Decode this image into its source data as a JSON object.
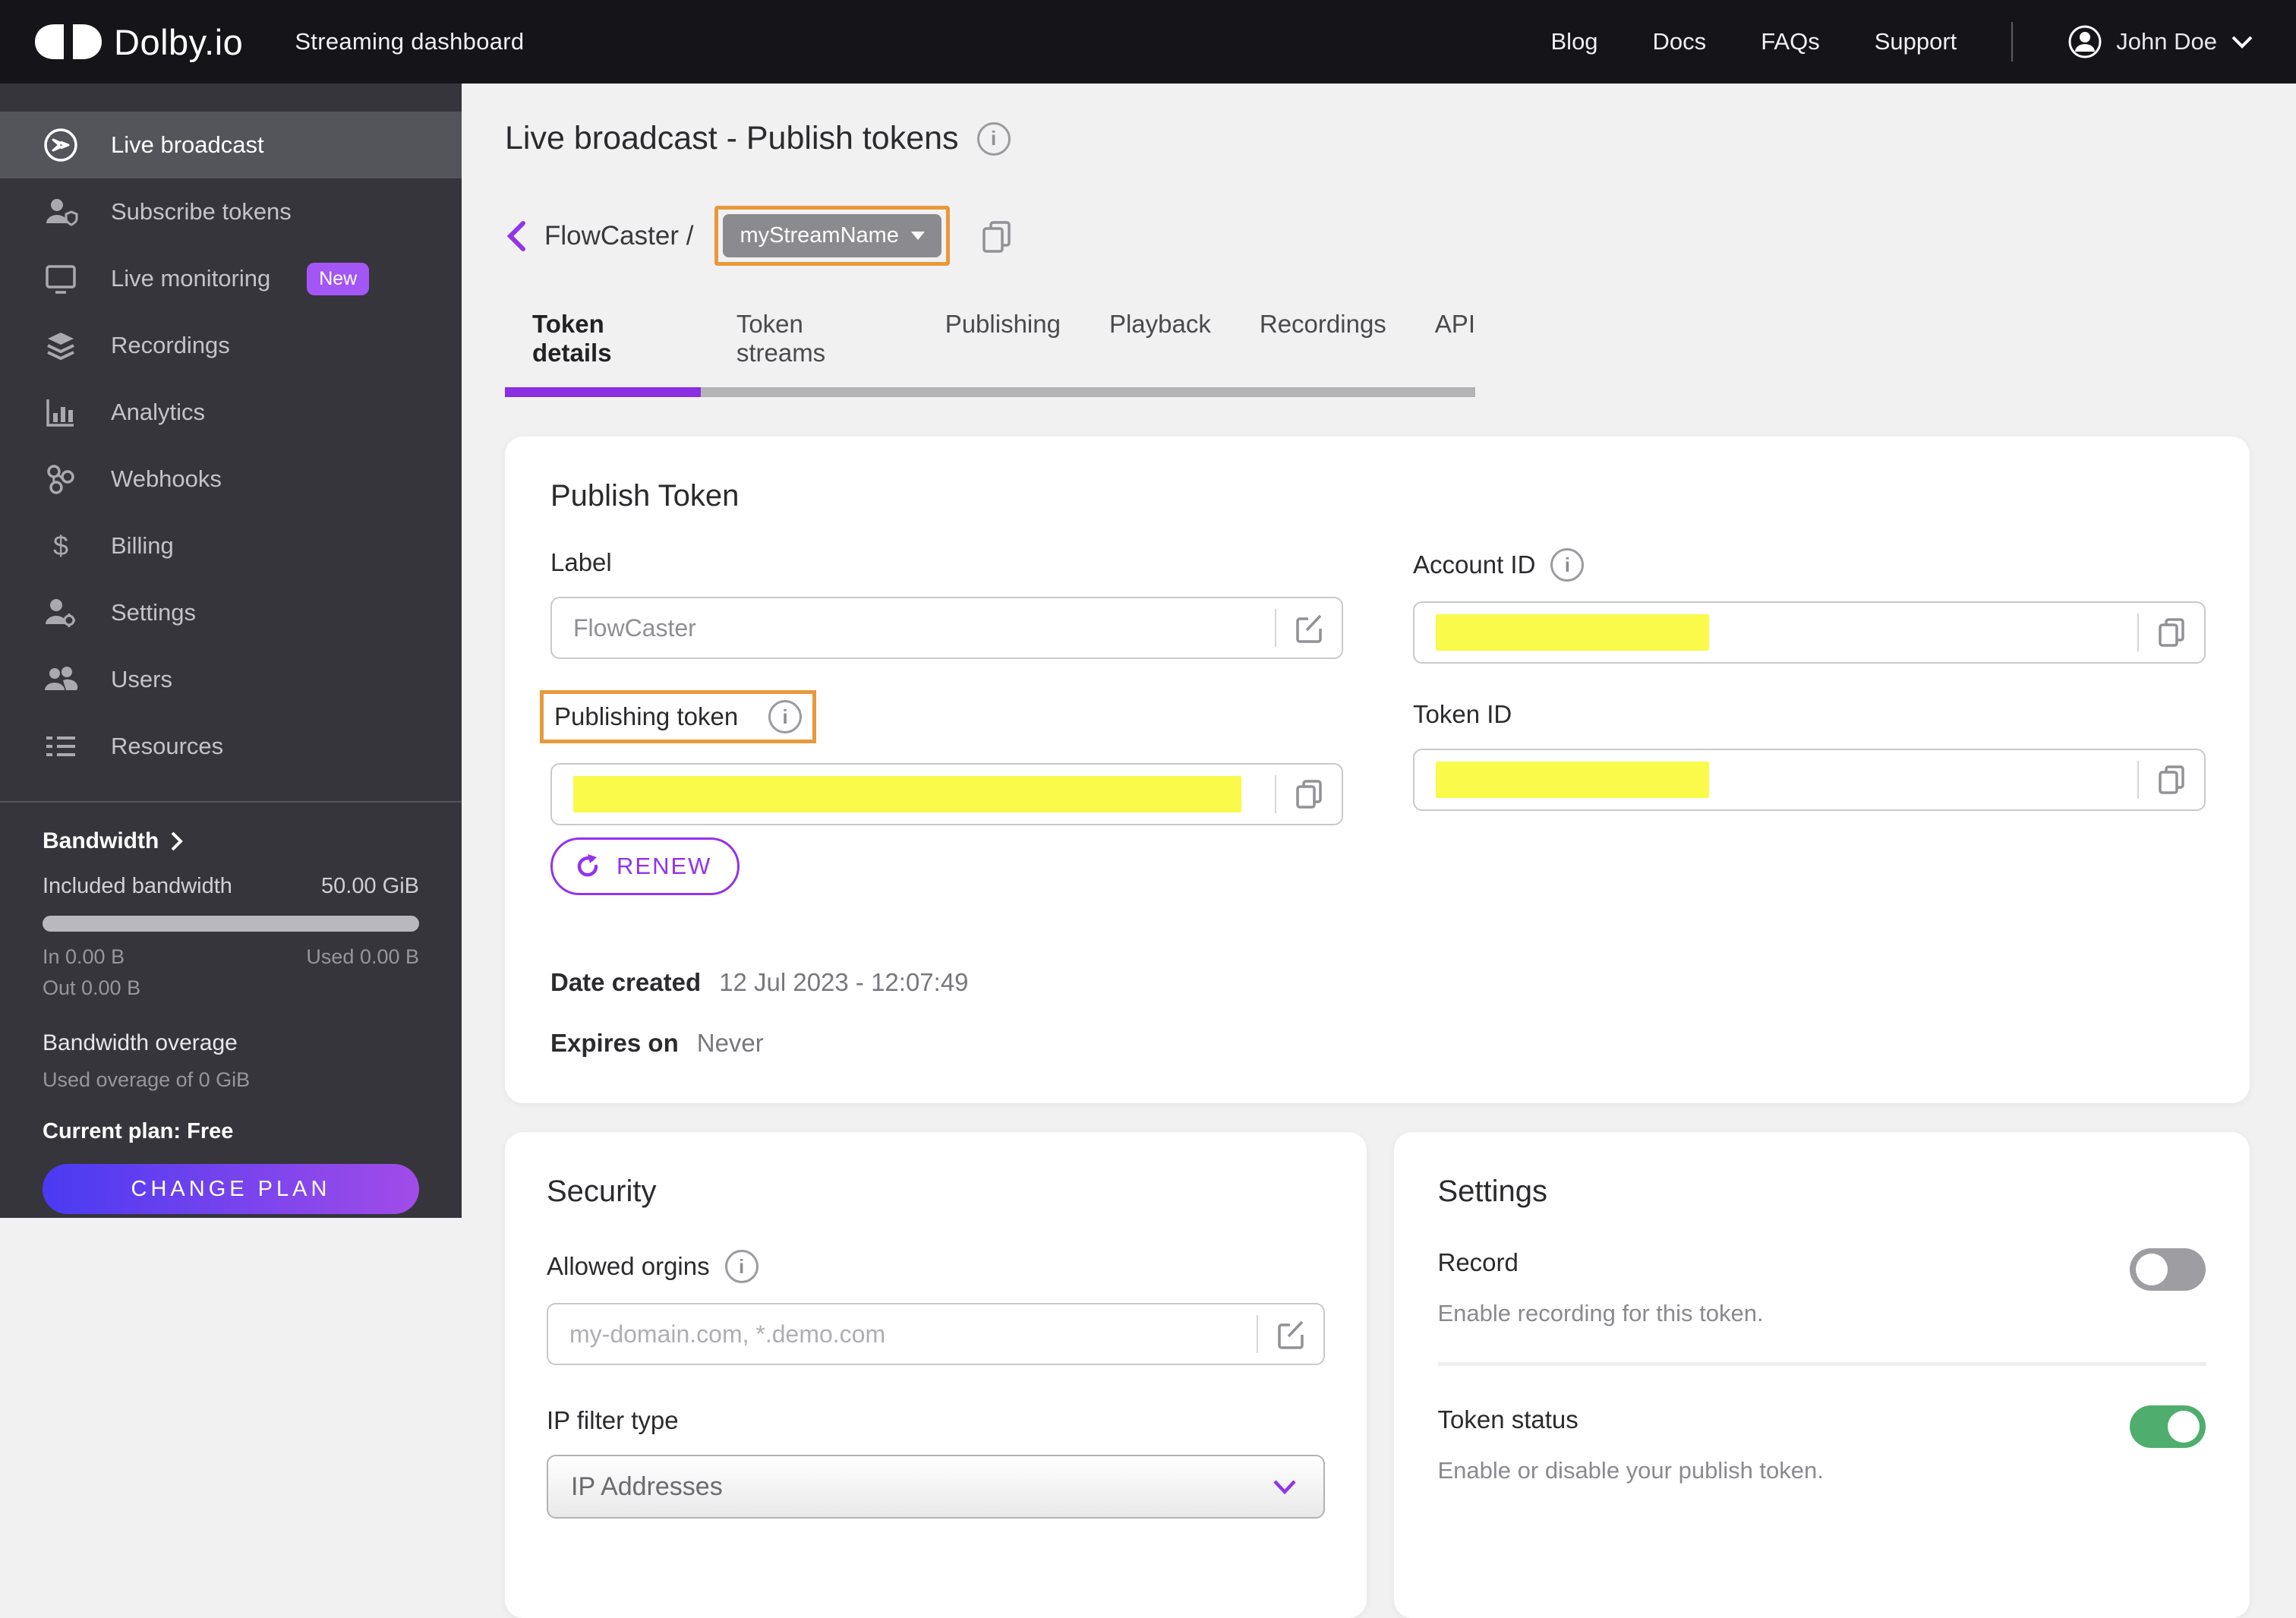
{
  "topbar": {
    "brand": "Dolby.io",
    "app_title": "Streaming dashboard",
    "nav": [
      "Blog",
      "Docs",
      "FAQs",
      "Support"
    ],
    "user": "John Doe"
  },
  "sidebar": {
    "items": [
      {
        "label": "Live broadcast"
      },
      {
        "label": "Subscribe tokens"
      },
      {
        "label": "Live monitoring",
        "badge": "New"
      },
      {
        "label": "Recordings"
      },
      {
        "label": "Analytics"
      },
      {
        "label": "Webhooks"
      },
      {
        "label": "Billing"
      },
      {
        "label": "Settings"
      },
      {
        "label": "Users"
      },
      {
        "label": "Resources"
      }
    ],
    "bandwidth": {
      "title": "Bandwidth",
      "included_label": "Included bandwidth",
      "included_value": "50.00 GiB",
      "in": "In 0.00 B",
      "out": "Out 0.00 B",
      "used": "Used 0.00 B",
      "overage_title": "Bandwidth overage",
      "overage_detail": "Used overage of 0 GiB",
      "plan": "Current plan: Free",
      "change_plan": "CHANGE PLAN"
    }
  },
  "main": {
    "page_title": "Live broadcast - Publish tokens",
    "breadcrumb": {
      "parent": "FlowCaster /",
      "stream": "myStreamName"
    },
    "tabs": [
      "Token details",
      "Token streams",
      "Publishing",
      "Playback",
      "Recordings",
      "API"
    ],
    "publish_token": {
      "title": "Publish Token",
      "label_field": "Label",
      "label_value": "FlowCaster",
      "account_id_label": "Account ID",
      "publishing_token_label": "Publishing token",
      "token_id_label": "Token ID",
      "renew": "RENEW",
      "date_created_label": "Date created",
      "date_created_value": "12 Jul 2023 - 12:07:49",
      "expires_label": "Expires on",
      "expires_value": "Never"
    },
    "security": {
      "title": "Security",
      "origins_label": "Allowed orgins",
      "origins_placeholder": "my-domain.com, *.demo.com",
      "ip_filter_label": "IP filter type",
      "ip_filter_value": "IP Addresses"
    },
    "settings": {
      "title": "Settings",
      "record_label": "Record",
      "record_desc": "Enable recording for this token.",
      "record_state": "off",
      "token_status_label": "Token status",
      "token_status_desc": "Enable or disable your publish token.",
      "token_status_state": "on"
    }
  },
  "colors": {
    "accent_purple": "#9333ea",
    "tab_underline": "#8b2fe2",
    "badge_purple": "#a355f5",
    "gradient_from": "#4a3af2",
    "gradient_to": "#a14ce8",
    "toggle_on_green": "#4fae6d",
    "redaction_yellow": "#fafa4b",
    "annotation_orange": "#e8993b"
  }
}
